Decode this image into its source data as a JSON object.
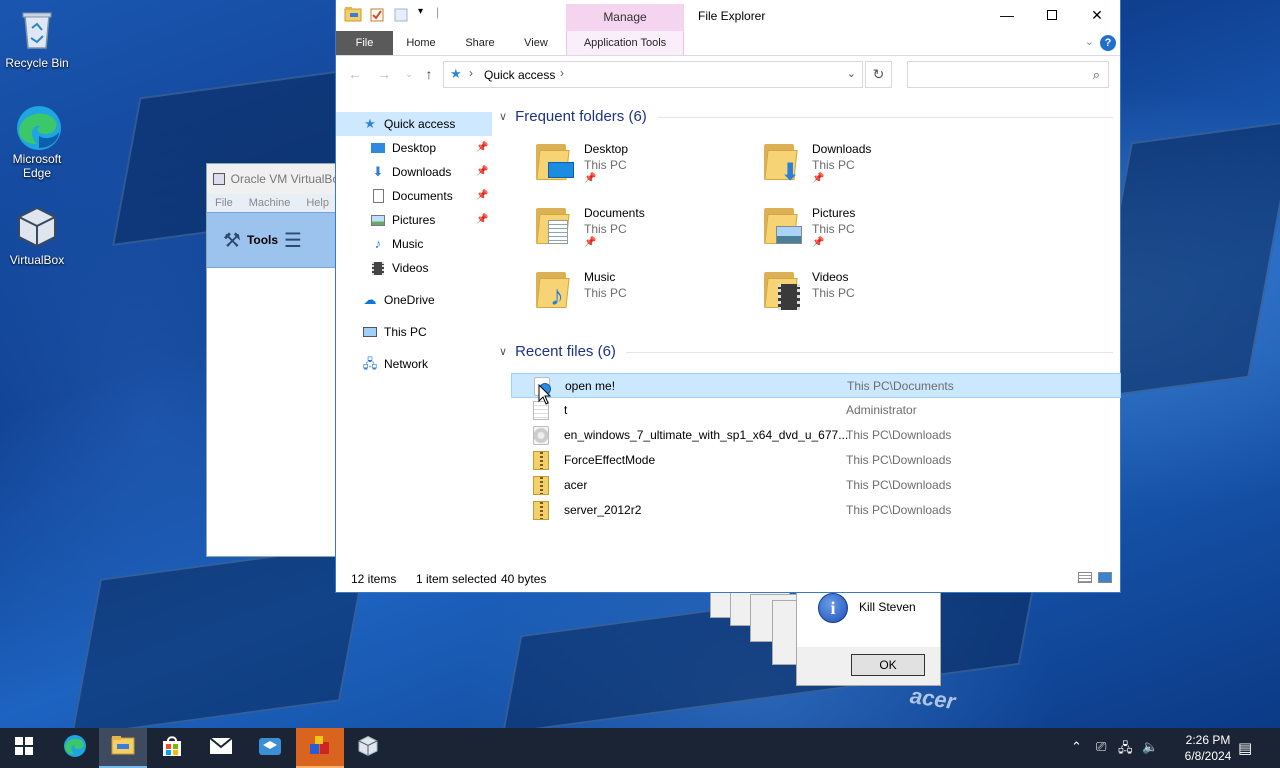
{
  "desktop": {
    "icons": [
      {
        "label": "Recycle Bin",
        "icon": "recycle-bin-icon"
      },
      {
        "label": "Microsoft Edge",
        "icon": "edge-icon"
      },
      {
        "label": "VirtualBox",
        "icon": "virtualbox-icon"
      }
    ],
    "wallpaper_brand": "acer"
  },
  "vbox_window": {
    "title": "Oracle VM VirtualBo",
    "menu": [
      "File",
      "Machine",
      "Help"
    ],
    "tools_label": "Tools"
  },
  "message_box": {
    "text": "Kill Steven",
    "ok_label": "OK"
  },
  "explorer": {
    "title": "File Explorer",
    "context_tab": "Manage",
    "tabs": [
      "File",
      "Home",
      "Share",
      "View",
      "Application Tools"
    ],
    "address": {
      "location": "Quick access"
    },
    "search_placeholder": "",
    "nav": [
      {
        "label": "Quick access",
        "icon": "star-icon",
        "pinned": false
      },
      {
        "label": "Desktop",
        "icon": "desktop-icon",
        "pinned": true
      },
      {
        "label": "Downloads",
        "icon": "download-arrow-icon",
        "pinned": true
      },
      {
        "label": "Documents",
        "icon": "documents-icon",
        "pinned": true
      },
      {
        "label": "Pictures",
        "icon": "pictures-icon",
        "pinned": true
      },
      {
        "label": "Music",
        "icon": "music-note-icon",
        "pinned": false
      },
      {
        "label": "Videos",
        "icon": "videos-icon",
        "pinned": false
      },
      {
        "label": "OneDrive",
        "icon": "cloud-icon",
        "pinned": false
      },
      {
        "label": "This PC",
        "icon": "computer-icon",
        "pinned": false
      },
      {
        "label": "Network",
        "icon": "network-icon",
        "pinned": false
      }
    ],
    "frequent_header": "Frequent folders (6)",
    "frequent": [
      {
        "name": "Desktop",
        "location": "This PC",
        "pinned": true
      },
      {
        "name": "Downloads",
        "location": "This PC",
        "pinned": true
      },
      {
        "name": "Documents",
        "location": "This PC",
        "pinned": true
      },
      {
        "name": "Pictures",
        "location": "This PC",
        "pinned": true
      },
      {
        "name": "Music",
        "location": "This PC",
        "pinned": false
      },
      {
        "name": "Videos",
        "location": "This PC",
        "pinned": false
      }
    ],
    "recent_header": "Recent files (6)",
    "recent": [
      {
        "name": "open me!",
        "location": "This PC\\Documents",
        "icon": "script-icon",
        "selected": true
      },
      {
        "name": "t",
        "location": "Administrator",
        "icon": "text-file-icon",
        "selected": false
      },
      {
        "name": "en_windows_7_ultimate_with_sp1_x64_dvd_u_677...",
        "location": "This PC\\Downloads",
        "icon": "disc-image-icon",
        "selected": false
      },
      {
        "name": "ForceEffectMode",
        "location": "This PC\\Downloads",
        "icon": "zip-icon",
        "selected": false
      },
      {
        "name": "acer",
        "location": "This PC\\Downloads",
        "icon": "zip-icon",
        "selected": false
      },
      {
        "name": "server_2012r2",
        "location": "This PC\\Downloads",
        "icon": "zip-icon",
        "selected": false
      }
    ],
    "status": {
      "items": "12 items",
      "selection": "1 item selected",
      "size": "40 bytes"
    }
  },
  "taskbar": {
    "clock_time": "2:26 PM",
    "clock_date": "6/8/2024",
    "colors": {
      "background": "#1b2434",
      "accent": "#76b9ed"
    }
  }
}
